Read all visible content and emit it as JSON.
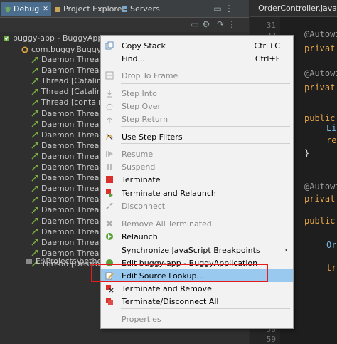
{
  "tabs": [
    {
      "label": "Debug",
      "close": "✕"
    },
    {
      "label": "Project Explorer"
    },
    {
      "label": "Servers"
    }
  ],
  "tree": [
    {
      "label": "buggy-app - BuggyApplication [Spring Boot App]",
      "icon": "launch-icon"
    },
    {
      "label": "com.buggy.BuggyApplication",
      "icon": "process-icon"
    },
    {
      "label": "Daemon Thread [",
      "icon": "thread-icon"
    },
    {
      "label": "Daemon Thread [",
      "icon": "thread-icon"
    },
    {
      "label": "Thread [Catalina-u",
      "icon": "thread-icon"
    },
    {
      "label": "Thread [Catalina-u",
      "icon": "thread-icon"
    },
    {
      "label": "Thread [container",
      "icon": "thread-icon"
    },
    {
      "label": "Daemon Thread [",
      "icon": "thread-icon"
    },
    {
      "label": "Daemon Thread [",
      "icon": "thread-icon"
    },
    {
      "label": "Daemon Thread [",
      "icon": "thread-icon"
    },
    {
      "label": "Daemon Thread [",
      "icon": "thread-icon"
    },
    {
      "label": "Daemon Thread [",
      "icon": "thread-icon"
    },
    {
      "label": "Daemon Thread [",
      "icon": "thread-icon"
    },
    {
      "label": "Daemon Thread [",
      "icon": "thread-icon"
    },
    {
      "label": "Daemon Thread [",
      "icon": "thread-icon"
    },
    {
      "label": "Daemon Thread [",
      "icon": "thread-icon"
    },
    {
      "label": "Daemon Thread [",
      "icon": "thread-icon"
    },
    {
      "label": "Daemon Thread [",
      "icon": "thread-icon"
    },
    {
      "label": "Daemon Thread [",
      "icon": "thread-icon"
    },
    {
      "label": "Daemon Thread [",
      "icon": "thread-icon"
    },
    {
      "label": "Daemon Thread [",
      "icon": "thread-icon"
    },
    {
      "label": "Thread [DestroyJa",
      "icon": "thread-icon"
    },
    {
      "label": "E:\\Projects\\bethedr",
      "icon": "java-exe-icon"
    }
  ],
  "editor": {
    "tab_label": "OrderController.java",
    "line_numbers": [
      "31",
      "32",
      "58",
      "59"
    ],
    "code": [
      {
        "text": "@Autowi",
        "color": "#9e9e9e"
      },
      {
        "text": "privat",
        "color": "#e3a34a"
      },
      {
        "text": "@Autowi",
        "color": "#9e9e9e"
      },
      {
        "text": "privat",
        "color": "#e3a34a"
      },
      {
        "text": "public",
        "color": "#e3a34a"
      },
      {
        "text": "Li",
        "color": "#76b7e0"
      },
      {
        "text": "re",
        "color": "#e3a34a"
      },
      {
        "text": "}",
        "color": "#d8d8d8"
      },
      {
        "text": "@Autowi",
        "color": "#9e9e9e"
      },
      {
        "text": "privat",
        "color": "#e3a34a"
      },
      {
        "text": "public",
        "color": "#e3a34a"
      },
      {
        "text": "Or",
        "color": "#76b7e0"
      },
      {
        "text": "tr",
        "color": "#e3a34a"
      }
    ]
  },
  "menu": {
    "items": [
      {
        "label": "Copy Stack",
        "shortcut": "Ctrl+C",
        "icon": "copy-icon",
        "enabled": true
      },
      {
        "label": "Find...",
        "shortcut": "Ctrl+F",
        "icon": "none",
        "enabled": true
      },
      {
        "label": "Drop To Frame",
        "icon": "drop-frame-icon",
        "enabled": false
      },
      {
        "label": "Step Into",
        "icon": "step-into-icon",
        "enabled": false
      },
      {
        "label": "Step Over",
        "icon": "step-over-icon",
        "enabled": false
      },
      {
        "label": "Step Return",
        "icon": "step-return-icon",
        "enabled": false
      },
      {
        "label": "Use Step Filters",
        "icon": "step-filter-icon",
        "enabled": true
      },
      {
        "label": "Resume",
        "icon": "resume-icon",
        "enabled": false
      },
      {
        "label": "Suspend",
        "icon": "suspend-icon",
        "enabled": false
      },
      {
        "label": "Terminate",
        "icon": "terminate-icon",
        "enabled": true
      },
      {
        "label": "Terminate and Relaunch",
        "icon": "terminate-relaunch-icon",
        "enabled": true
      },
      {
        "label": "Disconnect",
        "icon": "disconnect-icon",
        "enabled": false
      },
      {
        "label": "Remove All Terminated",
        "icon": "remove-all-icon",
        "enabled": false
      },
      {
        "label": "Relaunch",
        "icon": "relaunch-icon",
        "enabled": true
      },
      {
        "label": "Synchronize JavaScript Breakpoints",
        "icon": "none",
        "enabled": true,
        "submenu": "›"
      },
      {
        "label": "Edit buggy-app - BuggyApplication",
        "icon": "edit-config-icon",
        "enabled": true
      },
      {
        "label": "Edit Source Lookup...",
        "icon": "edit-source-icon",
        "enabled": true,
        "selected": true
      },
      {
        "label": "Terminate and Remove",
        "icon": "terminate-remove-icon",
        "enabled": true
      },
      {
        "label": "Terminate/Disconnect All",
        "icon": "terminate-all-icon",
        "enabled": true
      },
      {
        "label": "Properties",
        "icon": "none",
        "enabled": false
      }
    ]
  },
  "colors": {
    "accent_selected": "#99c9ef",
    "highlight_box": "#e41c1c"
  }
}
